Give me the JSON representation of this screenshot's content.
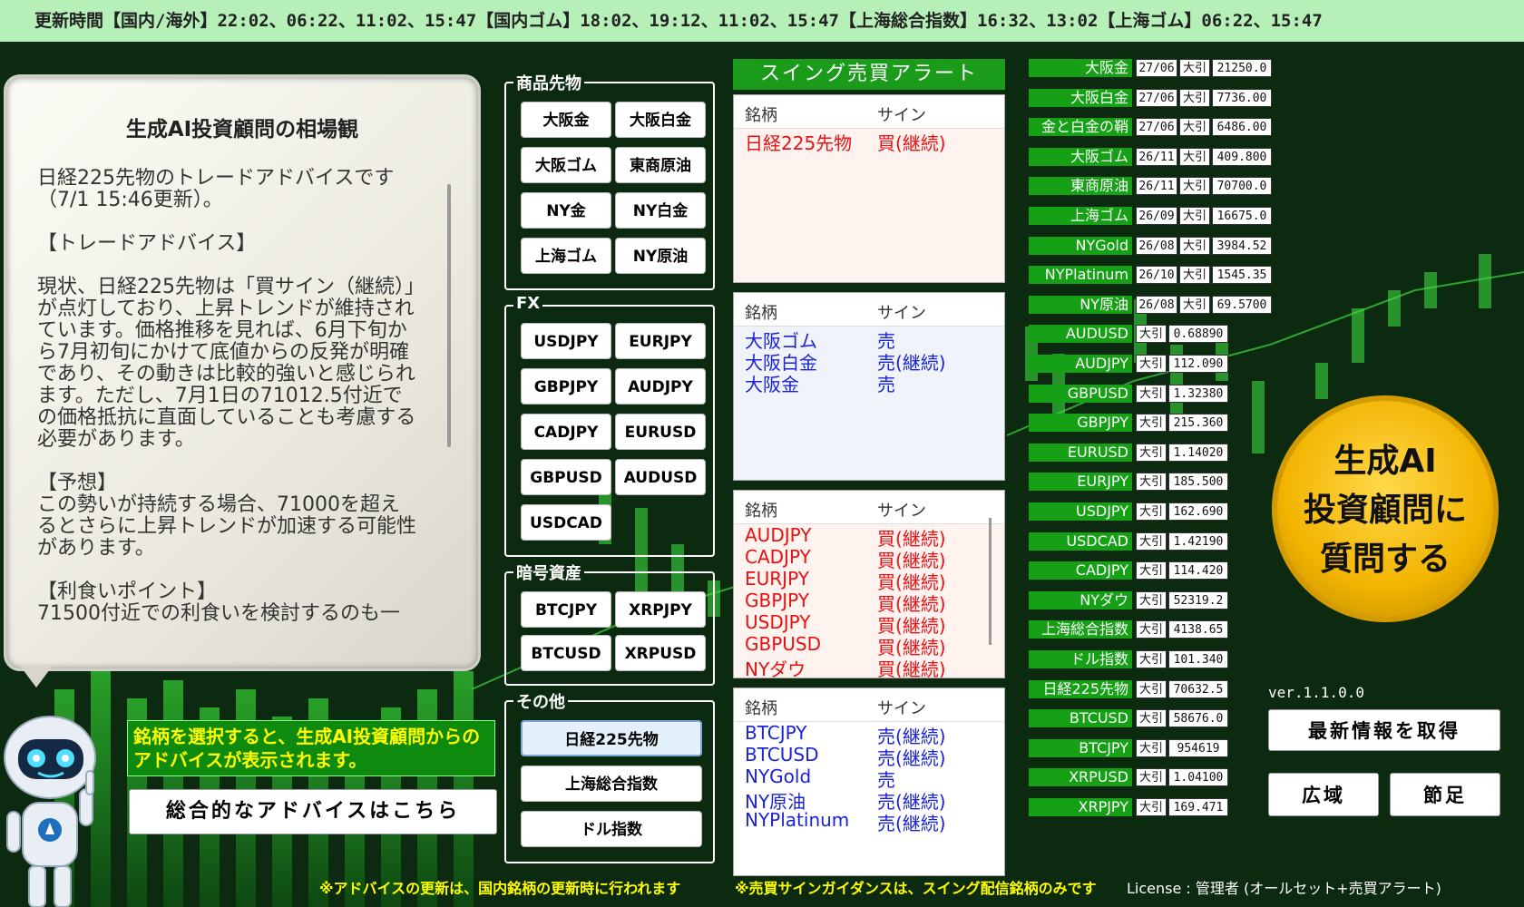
{
  "update_bar": "更新時間【国内/海外】22:02、06:22、11:02、15:47【国内ゴム】18:02、19:12、11:02、15:47【上海総合指数】16:32、13:02【上海ゴム】06:22、15:47",
  "advice": {
    "title": "生成AI投資顧問の相場観",
    "paragraphs": [
      "日経225先物のトレードアドバイスです（7/1 15:46更新）。",
      "【トレードアドバイス】",
      "現状、日経225先物は「買サイン（継続）」が点灯しており、上昇トレンドが維持されています。価格推移を見れば、6月下旬から7月初旬にかけて底値からの反発が明確であり、その動きは比較的強いと感じられます。ただし、7月1日の71012.5付近での価格抵抗に直面していることも考慮する必要があります。",
      "【予想】\nこの勢いが持続する場合、71000を超えるとさらに上昇トレンドが加速する可能性があります。",
      "【利食いポイント】\n71500付近での利食いを検討するのも一"
    ],
    "notice": "銘柄を選択すると、生成AI投資顧問からのアドバイスが表示されます。",
    "overall_button": "総合的なアドバイスはこちら"
  },
  "categories": {
    "commodities": {
      "label": "商品先物",
      "items": [
        "大阪金",
        "大阪白金",
        "大阪ゴム",
        "東商原油",
        "NY金",
        "NY白金",
        "上海ゴム",
        "NY原油"
      ]
    },
    "fx": {
      "label": "FX",
      "items": [
        "USDJPY",
        "EURJPY",
        "GBPJPY",
        "AUDJPY",
        "CADJPY",
        "EURUSD",
        "GBPUSD",
        "AUDUSD",
        "USDCAD"
      ]
    },
    "crypto": {
      "label": "暗号資産",
      "items": [
        "BTCJPY",
        "XRPJPY",
        "BTCUSD",
        "XRPUSD"
      ]
    },
    "other": {
      "label": "その他",
      "items": [
        "日経225先物",
        "上海総合指数",
        "ドル指数"
      ]
    }
  },
  "alerts": {
    "title": "スイング売買アラート",
    "col_name": "銘柄",
    "col_sign": "サイン",
    "box1": [
      {
        "name": "日経225先物",
        "sign": "買(継続)"
      }
    ],
    "box2": [
      {
        "name": "大阪ゴム",
        "sign": "売"
      },
      {
        "name": "大阪白金",
        "sign": "売(継続)"
      },
      {
        "name": "大阪金",
        "sign": "売"
      }
    ],
    "box3": [
      {
        "name": "AUDJPY",
        "sign": "買(継続)"
      },
      {
        "name": "CADJPY",
        "sign": "買(継続)"
      },
      {
        "name": "EURJPY",
        "sign": "買(継続)"
      },
      {
        "name": "GBPJPY",
        "sign": "買(継続)"
      },
      {
        "name": "USDJPY",
        "sign": "買(継続)"
      },
      {
        "name": "GBPUSD",
        "sign": "買(継続)"
      },
      {
        "name": "NYダウ",
        "sign": "買(継続)"
      }
    ],
    "box4": [
      {
        "name": "BTCJPY",
        "sign": "売(継続)"
      },
      {
        "name": "BTCUSD",
        "sign": "売(継続)"
      },
      {
        "name": "NYGold",
        "sign": "売"
      },
      {
        "name": "NY原油",
        "sign": "売(継続)"
      },
      {
        "name": "NYPlatinum",
        "sign": "売(継続)"
      }
    ]
  },
  "prices": [
    {
      "name": "大阪金",
      "month": "27/06",
      "tag": "大引",
      "value": "21250.0"
    },
    {
      "name": "大阪白金",
      "month": "27/06",
      "tag": "大引",
      "value": "7736.00"
    },
    {
      "name": "金と白金の鞘",
      "month": "27/06",
      "tag": "大引",
      "value": "6486.00"
    },
    {
      "name": "大阪ゴム",
      "month": "26/11",
      "tag": "大引",
      "value": "409.800"
    },
    {
      "name": "東商原油",
      "month": "26/11",
      "tag": "大引",
      "value": "70700.0"
    },
    {
      "name": "上海ゴム",
      "month": "26/09",
      "tag": "大引",
      "value": "16675.0"
    },
    {
      "name": "NYGold",
      "month": "26/08",
      "tag": "大引",
      "value": "3984.52"
    },
    {
      "name": "NYPlatinum",
      "month": "26/10",
      "tag": "大引",
      "value": "1545.35"
    },
    {
      "name": "NY原油",
      "month": "26/08",
      "tag": "大引",
      "value": "69.5700"
    },
    {
      "name": "AUDUSD",
      "month": "",
      "tag": "大引",
      "value": "0.68890"
    },
    {
      "name": "AUDJPY",
      "month": "",
      "tag": "大引",
      "value": "112.090"
    },
    {
      "name": "GBPUSD",
      "month": "",
      "tag": "大引",
      "value": "1.32380"
    },
    {
      "name": "GBPJPY",
      "month": "",
      "tag": "大引",
      "value": "215.360"
    },
    {
      "name": "EURUSD",
      "month": "",
      "tag": "大引",
      "value": "1.14020"
    },
    {
      "name": "EURJPY",
      "month": "",
      "tag": "大引",
      "value": "185.500"
    },
    {
      "name": "USDJPY",
      "month": "",
      "tag": "大引",
      "value": "162.690"
    },
    {
      "name": "USDCAD",
      "month": "",
      "tag": "大引",
      "value": "1.42190"
    },
    {
      "name": "CADJPY",
      "month": "",
      "tag": "大引",
      "value": "114.420"
    },
    {
      "name": "NYダウ",
      "month": "",
      "tag": "大引",
      "value": "52319.2"
    },
    {
      "name": "上海総合指数",
      "month": "",
      "tag": "大引",
      "value": "4138.65"
    },
    {
      "name": "ドル指数",
      "month": "",
      "tag": "大引",
      "value": "101.340"
    },
    {
      "name": "日経225先物",
      "month": "",
      "tag": "大引",
      "value": "70632.5"
    },
    {
      "name": "BTCUSD",
      "month": "",
      "tag": "大引",
      "value": "58676.0"
    },
    {
      "name": "BTCJPY",
      "month": "",
      "tag": "大引",
      "value": "954619"
    },
    {
      "name": "XRPUSD",
      "month": "",
      "tag": "大引",
      "value": "1.04100"
    },
    {
      "name": "XRPJPY",
      "month": "",
      "tag": "大引",
      "value": "169.471"
    }
  ],
  "ask_button": [
    "生成AI",
    "投資顧問に",
    "質問する"
  ],
  "version": "ver.1.1.0.0",
  "buttons": {
    "refresh": "最新情報を取得",
    "wide": "広域",
    "section": "節足"
  },
  "footer": {
    "note1": "※アドバイスの更新は、国内銘柄の更新時に行われます",
    "note2": "※売買サインガイダンスは、スイング配信銘柄のみです",
    "license": "License : 管理者 (オールセット+売買アラート)"
  },
  "colors": {
    "buy": "#e81010",
    "sell": "#1a22d6",
    "accent_green": "#15a015",
    "background": "#0b2a10"
  }
}
